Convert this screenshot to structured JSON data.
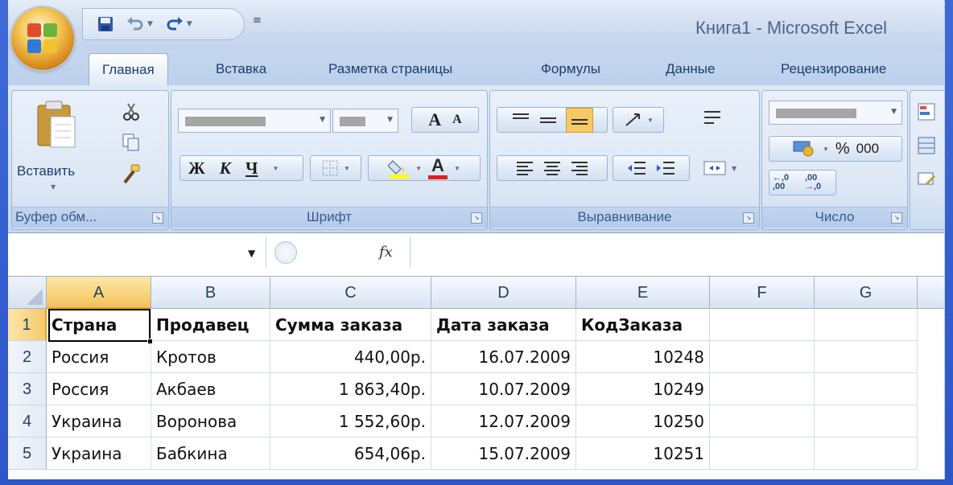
{
  "window": {
    "title": "Книга1 - Microsoft Excel"
  },
  "quick_access": {
    "items": [
      "save-icon",
      "undo-icon",
      "redo-icon",
      "customize-icon"
    ]
  },
  "tabs": [
    {
      "label": "Главная",
      "active": true
    },
    {
      "label": "Вставка",
      "active": false
    },
    {
      "label": "Разметка страницы",
      "active": false
    },
    {
      "label": "Формулы",
      "active": false
    },
    {
      "label": "Данные",
      "active": false
    },
    {
      "label": "Рецензирование",
      "active": false
    }
  ],
  "ribbon": {
    "clipboard": {
      "paste_label": "Вставить",
      "group_label": "Буфер обм..."
    },
    "font": {
      "group_label": "Шрифт",
      "bold": "Ж",
      "italic": "К",
      "underline": "Ч",
      "grow": "A",
      "shrink": "A",
      "font_color": "A"
    },
    "alignment": {
      "group_label": "Выравнивание"
    },
    "number": {
      "group_label": "Число",
      "percent": "%",
      "thousands": "000",
      "inc_decimal": "←,0 ,00",
      "dec_decimal": ",00 →,0"
    }
  },
  "formula_bar": {
    "fx": "fx"
  },
  "sheet": {
    "columns": [
      "A",
      "B",
      "C",
      "D",
      "E",
      "F",
      "G"
    ],
    "rows": [
      "1",
      "2",
      "3",
      "4",
      "5"
    ],
    "headers": [
      "Страна",
      "Продавец",
      "Сумма заказа",
      "Дата заказа",
      "КодЗаказа"
    ],
    "data": [
      [
        "Россия",
        "Кротов",
        "440,00р.",
        "16.07.2009",
        "10248"
      ],
      [
        "Россия",
        "Акбаев",
        "1 863,40р.",
        "10.07.2009",
        "10249"
      ],
      [
        "Украина",
        "Воронова",
        "1 552,60р.",
        "12.07.2009",
        "10250"
      ],
      [
        "Украина",
        "Бабкина",
        "654,06р.",
        "15.07.2009",
        "10251"
      ]
    ],
    "selected_cell": "A1"
  },
  "colors": {
    "accent": "#f2bf5a",
    "ribbon": "#dde8f6",
    "title_text": "#4e6488"
  }
}
